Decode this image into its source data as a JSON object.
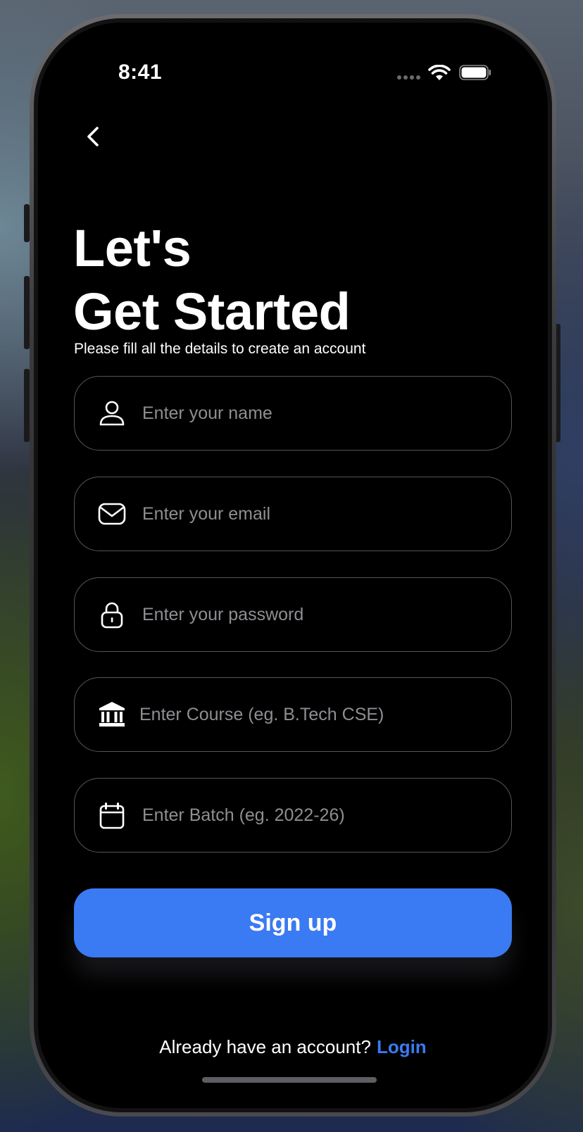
{
  "status_bar": {
    "time": "8:41",
    "icons": [
      "signal-dots-icon",
      "wifi-icon",
      "battery-icon"
    ]
  },
  "nav": {
    "back_icon": "chevron-left-icon"
  },
  "header": {
    "title_line1": "Let's",
    "title_line2": "Get Started",
    "subtitle": "Please fill all the details to create an account"
  },
  "form": {
    "fields": [
      {
        "icon": "person-icon",
        "placeholder": "Enter your name"
      },
      {
        "icon": "envelope-icon",
        "placeholder": "Enter your email"
      },
      {
        "icon": "lock-icon",
        "placeholder": "Enter your password"
      },
      {
        "icon": "institution-icon",
        "placeholder": "Enter Course (eg. B.Tech CSE)"
      },
      {
        "icon": "calendar-icon",
        "placeholder": "Enter Batch (eg. 2022-26)"
      }
    ],
    "submit_label": "Sign up"
  },
  "footer": {
    "prompt": "Already have an account?",
    "login_label": "Login"
  },
  "colors": {
    "accent": "#3a7af2",
    "background": "#000000",
    "placeholder": "#8e8e93",
    "field_border": "#55555a"
  }
}
